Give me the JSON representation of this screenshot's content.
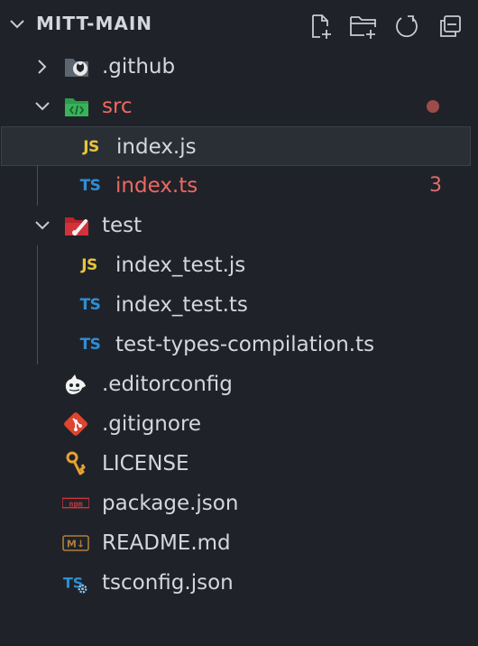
{
  "header": {
    "title": "MITT-MAIN",
    "actions": [
      {
        "name": "new-file",
        "icon": "new-file-icon"
      },
      {
        "name": "new-folder",
        "icon": "new-folder-icon"
      },
      {
        "name": "refresh",
        "icon": "refresh-icon"
      },
      {
        "name": "collapse-all",
        "icon": "collapse-all-icon"
      }
    ]
  },
  "tree": {
    "github": {
      "label": ".github",
      "icon": "github-folder-icon",
      "expanded": false
    },
    "src": {
      "label": "src",
      "icon": "src-folder-icon",
      "expanded": true,
      "status": "error",
      "status_color": "#9e4b4b"
    },
    "src_index_js": {
      "label": "index.js",
      "icon_text": "JS",
      "selected": true
    },
    "src_index_ts": {
      "label": "index.ts",
      "icon_text": "TS",
      "problems": "3"
    },
    "test": {
      "label": "test",
      "icon": "test-folder-icon",
      "expanded": true
    },
    "test_index_test_js": {
      "label": "index_test.js",
      "icon_text": "JS"
    },
    "test_index_test_ts": {
      "label": "index_test.ts",
      "icon_text": "TS"
    },
    "test_types_compilation": {
      "label": "test-types-compilation.ts",
      "icon_text": "TS"
    },
    "editorconfig": {
      "label": ".editorconfig",
      "icon": "editorconfig-icon"
    },
    "gitignore": {
      "label": ".gitignore",
      "icon": "git-icon"
    },
    "license": {
      "label": "LICENSE",
      "icon": "license-key-icon"
    },
    "package_json": {
      "label": "package.json",
      "icon": "npm-icon",
      "icon_text": "npm"
    },
    "readme": {
      "label": "README.md",
      "icon": "markdown-icon",
      "icon_text": "M↓"
    },
    "tsconfig": {
      "label": "tsconfig.json",
      "icon": "tsconfig-icon",
      "icon_text": "TS"
    }
  },
  "colors": {
    "background": "#1f2329",
    "selected_bg": "#2a2f36",
    "error_text": "#f0675f",
    "js_yellow": "#e8c43a",
    "ts_blue": "#2f8ed6"
  }
}
